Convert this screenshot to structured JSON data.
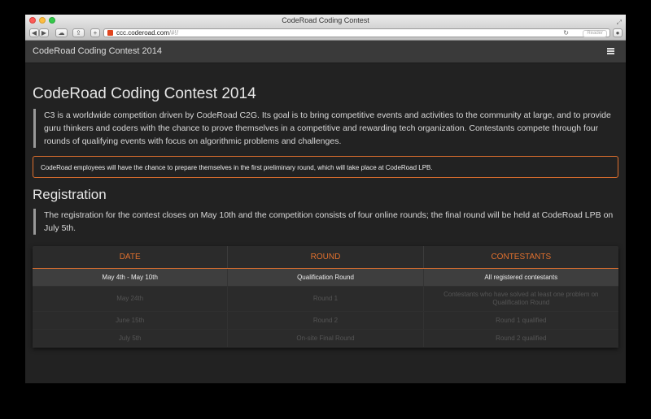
{
  "window": {
    "title": "CodeRoad Coding Contest"
  },
  "toolbar": {
    "url_host": "ccc.coderoad.com",
    "url_path": "/#!/",
    "reader_label": "Reader"
  },
  "navbar": {
    "brand": "CodeRoad Coding Contest 2014"
  },
  "main": {
    "title": "CodeRoad Coding Contest 2014",
    "intro": "C3 is a worldwide competition driven by CodeRoad C2G. Its goal is to bring competitive events and activities to the community at large, and to provide guru thinkers and coders with the chance to prove themselves in a competitive and rewarding tech organization. Contestants compete through four rounds of qualifying events with focus on algorithmic problems and challenges.",
    "alert": "CodeRoad employees will have the chance to prepare themselves in the first preliminary round, which will take place at CodeRoad LPB.",
    "registration_title": "Registration",
    "registration_text": "The registration for the contest closes on May 10th and the competition consists of four online rounds; the final round will be held at CodeRoad LPB on July 5th."
  },
  "table": {
    "headers": [
      "DATE",
      "ROUND",
      "CONTESTANTS"
    ],
    "rows": [
      [
        "May 4th - May 10th",
        "Qualification Round",
        "All registered contestants"
      ],
      [
        "May 24th",
        "Round 1",
        "Contestants who have solved at least one problem on Qualification Round"
      ],
      [
        "June 15th",
        "Round 2",
        "Round 1 qualified"
      ],
      [
        "July 5th",
        "On-site Final Round",
        "Round 2 qualified"
      ]
    ]
  },
  "colors": {
    "accent": "#e0702e",
    "background": "#222222",
    "navbar": "#3a3a3a"
  }
}
